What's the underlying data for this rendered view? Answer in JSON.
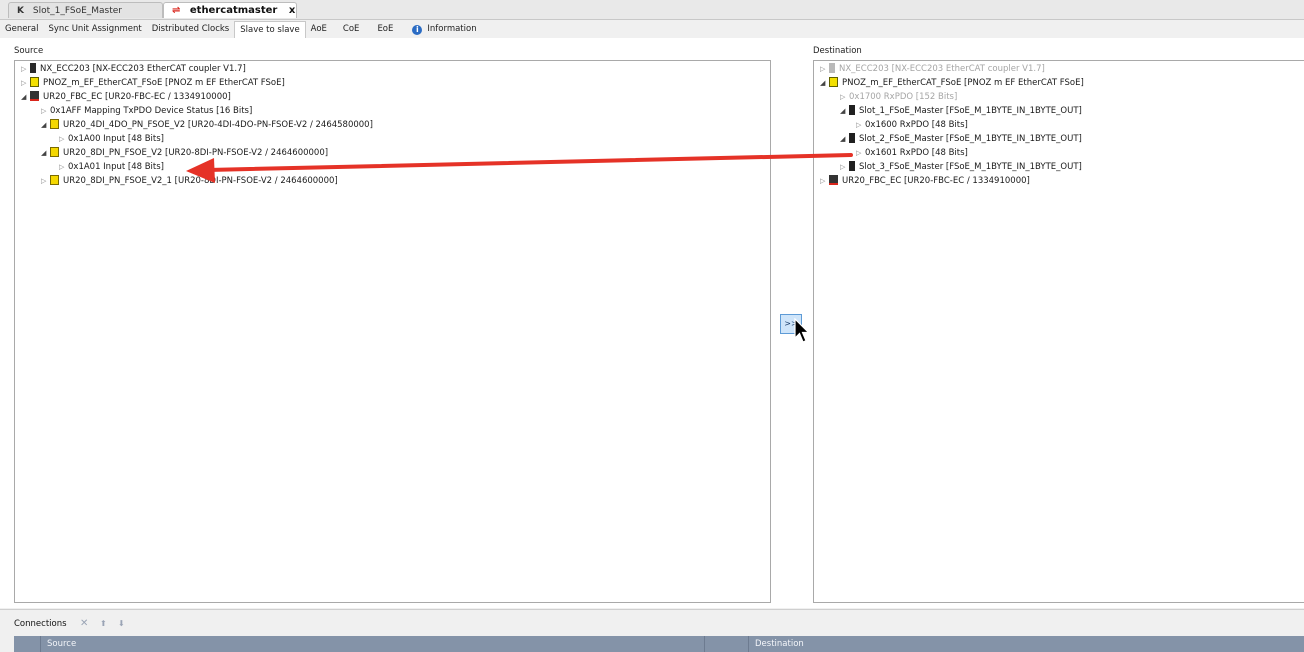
{
  "doc_tabs": [
    {
      "label": "Slot_1_FSoE_Master",
      "active": false,
      "icon": "slot-icon"
    },
    {
      "label": "ethercatmaster",
      "active": true,
      "icon": "ethercat-icon",
      "close": "x"
    }
  ],
  "editor_tabs": [
    {
      "label": "General"
    },
    {
      "label": "Sync Unit Assignment"
    },
    {
      "label": "Distributed Clocks"
    },
    {
      "label": "Slave to slave",
      "active": true
    },
    {
      "label": "AoE"
    },
    {
      "label": "CoE"
    },
    {
      "label": "EoE"
    },
    {
      "label": "Information",
      "icon": "info-icon"
    }
  ],
  "source": {
    "label": "Source",
    "rows": [
      {
        "text": "NX_ECC203 [NX-ECC203 EtherCAT coupler V1.7]",
        "expander": "▷",
        "icon": "device-icon",
        "depth": 0
      },
      {
        "text": "PNOZ_m_EF_EtherCAT_FSoE [PNOZ m EF EtherCAT FSoE]",
        "expander": "▷",
        "icon": "pnoz-icon",
        "depth": 0
      },
      {
        "text": "UR20_FBC_EC [UR20-FBC-EC / 1334910000]",
        "expander": "◢",
        "icon": "coupler-icon",
        "depth": 0
      },
      {
        "text": "0x1AFF Mapping TxPDO Device Status [16 Bits]",
        "expander": "▷",
        "icon": "",
        "depth": 1
      },
      {
        "text": "UR20_4DI_4DO_PN_FSOE_V2 [UR20-4DI-4DO-PN-FSOE-V2 / 2464580000]",
        "expander": "◢",
        "icon": "module-icon",
        "depth": 1
      },
      {
        "text": "0x1A00 Input [48 Bits]",
        "expander": "▷",
        "icon": "",
        "depth": 2
      },
      {
        "text": "UR20_8DI_PN_FSOE_V2 [UR20-8DI-PN-FSOE-V2 / 2464600000]",
        "expander": "◢",
        "icon": "module-icon",
        "depth": 1
      },
      {
        "text": "0x1A01 Input [48 Bits]",
        "expander": "▷",
        "icon": "",
        "depth": 2
      },
      {
        "text": "UR20_8DI_PN_FSOE_V2_1 [UR20-8DI-PN-FSOE-V2 / 2464600000]",
        "expander": "▷",
        "icon": "module-icon",
        "depth": 1
      }
    ]
  },
  "destination": {
    "label": "Destination",
    "rows": [
      {
        "text": "NX_ECC203 [NX-ECC203 EtherCAT coupler V1.7]",
        "expander": "▷",
        "icon": "device-dim-icon",
        "depth": 0,
        "dim": true
      },
      {
        "text": "PNOZ_m_EF_EtherCAT_FSoE [PNOZ m EF EtherCAT FSoE]",
        "expander": "◢",
        "icon": "pnoz-icon",
        "depth": 0
      },
      {
        "text": "0x1700 RxPDO [152 Bits]",
        "expander": "▷",
        "icon": "",
        "depth": 1,
        "dim": true
      },
      {
        "text": "Slot_1_FSoE_Master [FSoE_M_1BYTE_IN_1BYTE_OUT]",
        "expander": "◢",
        "icon": "slot-icon",
        "depth": 1
      },
      {
        "text": "0x1600 RxPDO [48 Bits]",
        "expander": "▷",
        "icon": "",
        "depth": 2
      },
      {
        "text": "Slot_2_FSoE_Master [FSoE_M_1BYTE_IN_1BYTE_OUT]",
        "expander": "◢",
        "icon": "slot-icon",
        "depth": 1
      },
      {
        "text": "0x1601 RxPDO [48 Bits]",
        "expander": "▷",
        "icon": "",
        "depth": 2
      },
      {
        "text": "Slot_3_FSoE_Master [FSoE_M_1BYTE_IN_1BYTE_OUT]",
        "expander": "▷",
        "icon": "slot-icon",
        "depth": 1
      },
      {
        "text": "UR20_FBC_EC [UR20-FBC-EC / 1334910000]",
        "expander": "▷",
        "icon": "coupler-icon",
        "depth": 0
      }
    ]
  },
  "transfer_button": {
    "label": ">>"
  },
  "connections": {
    "label": "Connections",
    "tools": [
      "delete-icon",
      "move-up-icon",
      "move-down-icon"
    ],
    "columns": [
      "Source",
      "Destination"
    ]
  },
  "annotation": {
    "arrow_color": "#e53227"
  }
}
